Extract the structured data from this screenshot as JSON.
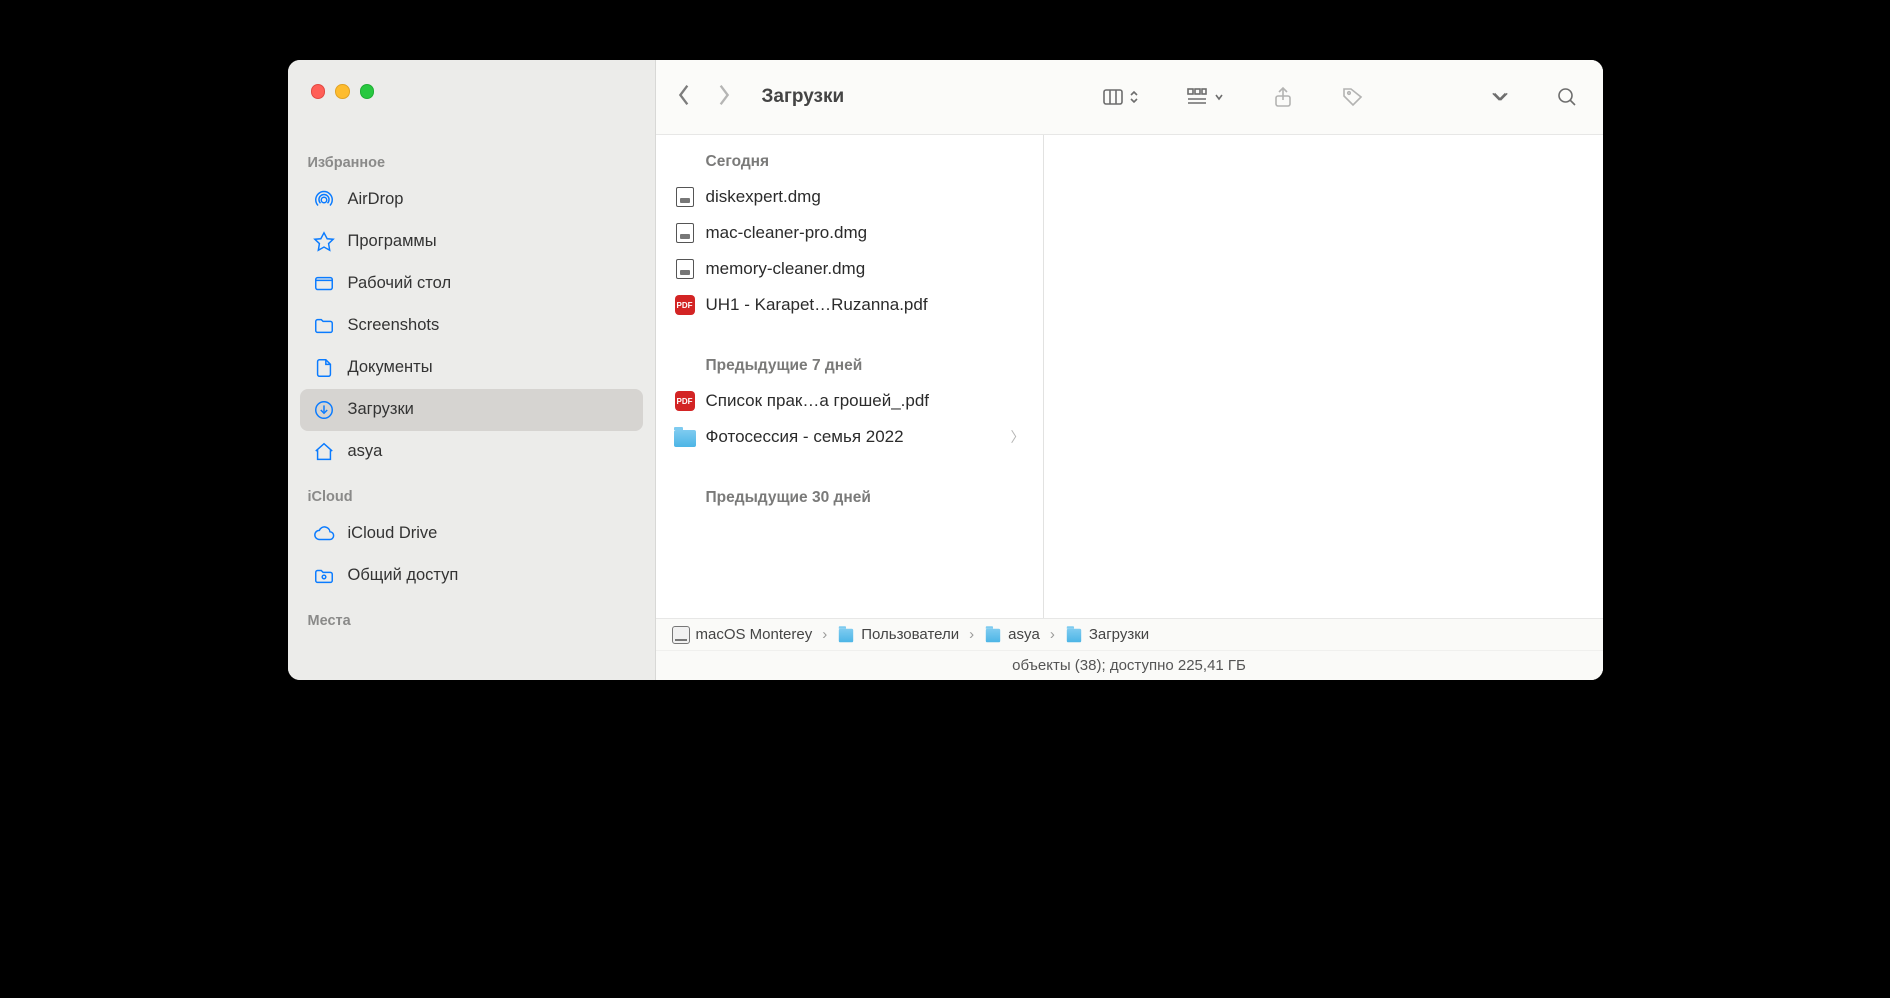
{
  "toolbar": {
    "title": "Загрузки"
  },
  "sidebar": {
    "sections": [
      {
        "title": "Избранное",
        "items": [
          {
            "label": "AirDrop",
            "icon": "airdrop-icon"
          },
          {
            "label": "Программы",
            "icon": "apps-icon"
          },
          {
            "label": "Рабочий стол",
            "icon": "desktop-icon"
          },
          {
            "label": "Screenshots",
            "icon": "folder-icon"
          },
          {
            "label": "Документы",
            "icon": "document-icon"
          },
          {
            "label": "Загрузки",
            "icon": "downloads-icon",
            "selected": true
          },
          {
            "label": "asya",
            "icon": "home-icon"
          }
        ]
      },
      {
        "title": "iCloud",
        "items": [
          {
            "label": "iCloud Drive",
            "icon": "cloud-icon"
          },
          {
            "label": "Общий доступ",
            "icon": "shared-icon"
          }
        ]
      },
      {
        "title": "Места",
        "items": []
      }
    ]
  },
  "files": {
    "groups": [
      {
        "heading": "Сегодня",
        "items": [
          {
            "name": "diskexpert.dmg",
            "type": "dmg"
          },
          {
            "name": "mac-cleaner-pro.dmg",
            "type": "dmg"
          },
          {
            "name": "memory-cleaner.dmg",
            "type": "dmg"
          },
          {
            "name": "UH1 - Karapet…Ruzanna.pdf",
            "type": "pdf"
          }
        ]
      },
      {
        "heading": "Предыдущие 7 дней",
        "items": [
          {
            "name": "Список прак…а грошей_.pdf",
            "type": "pdf"
          },
          {
            "name": "Фотосессия - семья 2022",
            "type": "folder",
            "arrow": true
          }
        ]
      },
      {
        "heading": "Предыдущие 30 дней",
        "items": []
      }
    ]
  },
  "pathbar": [
    {
      "label": "macOS Monterey",
      "icon": "disk"
    },
    {
      "label": "Пользователи",
      "icon": "folder"
    },
    {
      "label": "asya",
      "icon": "folder"
    },
    {
      "label": "Загрузки",
      "icon": "folder"
    }
  ],
  "status": "объекты (38); доступно 225,41 ГБ"
}
